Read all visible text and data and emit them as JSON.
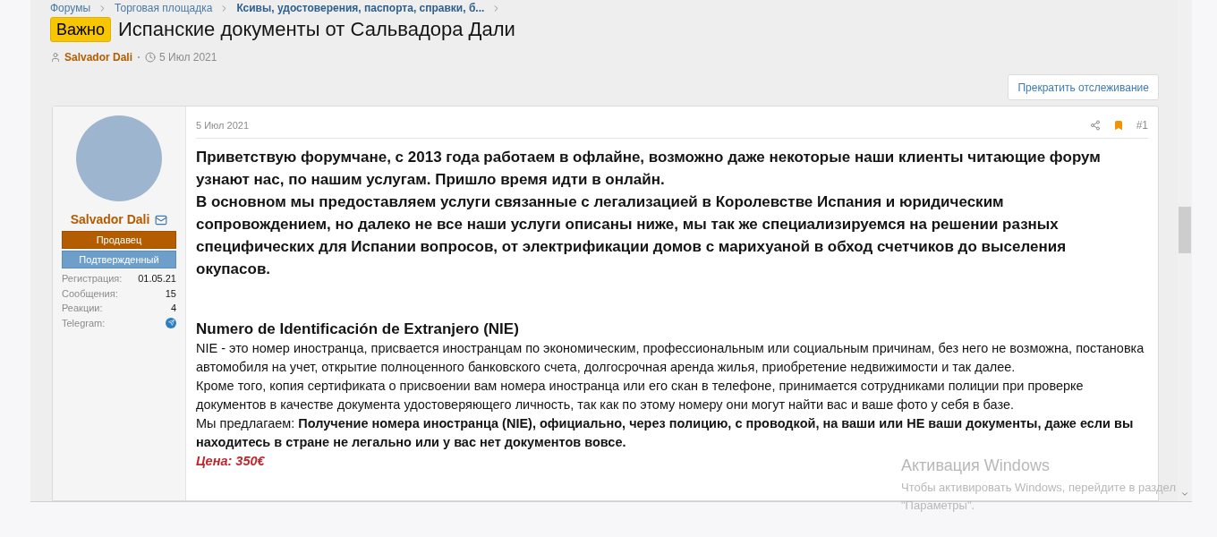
{
  "breadcrumbs": [
    {
      "label": "Форумы",
      "current": false
    },
    {
      "label": "Торговая площадка",
      "current": false
    },
    {
      "label": "Ксивы, удостоверения, паспорта, справки, б...",
      "current": true
    }
  ],
  "thread": {
    "prefix": "Важно",
    "title": "Испанские документы от Сальвадора Дали",
    "author": "Salvador Dali",
    "date": "5 Июл 2021"
  },
  "watch_button": "Прекратить отслеживание",
  "post": {
    "user": {
      "name": "Salvador Dali",
      "banners": [
        {
          "label": "Продавец",
          "color": "#b35c00"
        },
        {
          "label": "Подтвержденный",
          "color": "#6e9fcb"
        }
      ],
      "stats": [
        {
          "kind": "text",
          "label": "Регистрация:",
          "value": "01.05.21"
        },
        {
          "kind": "text",
          "label": "Сообщения:",
          "value": "15"
        },
        {
          "kind": "text",
          "label": "Реакции:",
          "value": "4"
        },
        {
          "kind": "telegram",
          "label": "Telegram:"
        }
      ]
    },
    "date": "5 Июл 2021",
    "bookmarked": true,
    "number": "#1",
    "intro": [
      "Приветствую форумчане, с 2013 года работаем в офлайне, возможно даже некоторые наши клиенты читающие форум узнают нас, по нашим услугам. Пришло время идти в онлайн.",
      "В основном мы предоставляем услуги связанные с легализацией в Королевстве Испания и юридическим сопровождением, но далеко не все наши услуги описаны ниже, мы так же специализируемся на решении разных специфических для Испании вопросов, от электрификации домов с марихуаной в обход счетчиков до выселения окупасов."
    ],
    "sections": [
      {
        "heading": "Numero de Identificación de Extranjero (NIE)",
        "paragraphs": [
          "NIE - это номер иностранца, присвается иностранцам по экономическим, профессиональным или социальным причинам, без него не возможна, постановка автомобиля на учет, открытие полноценного банковского счета, долгосрочная аренда жилья, приобретение недвижимости и так далее.",
          "Кроме того, копия сертификата о присвоении вам номера иностранца или его скан в телефоне, принимается сотрудниками полиции при проверке документов в качестве документа удостоверяющего личность, так как по этому номеру они могут найти вас и ваше фото у себя в базе.",
          "Мы предлагаем: **Получение номера иностранца (NIE), официально, через полицию, с проводкой, на ваши или НЕ ваши документы, даже если вы находитесь в стране не легально или у вас нет документов вовсе.**"
        ],
        "price": "Цена: 350€"
      }
    ]
  },
  "os_notice": {
    "title": "Активация Windows",
    "text": "Чтобы активировать Windows, перейдите в раздел \"Параметры\"."
  }
}
